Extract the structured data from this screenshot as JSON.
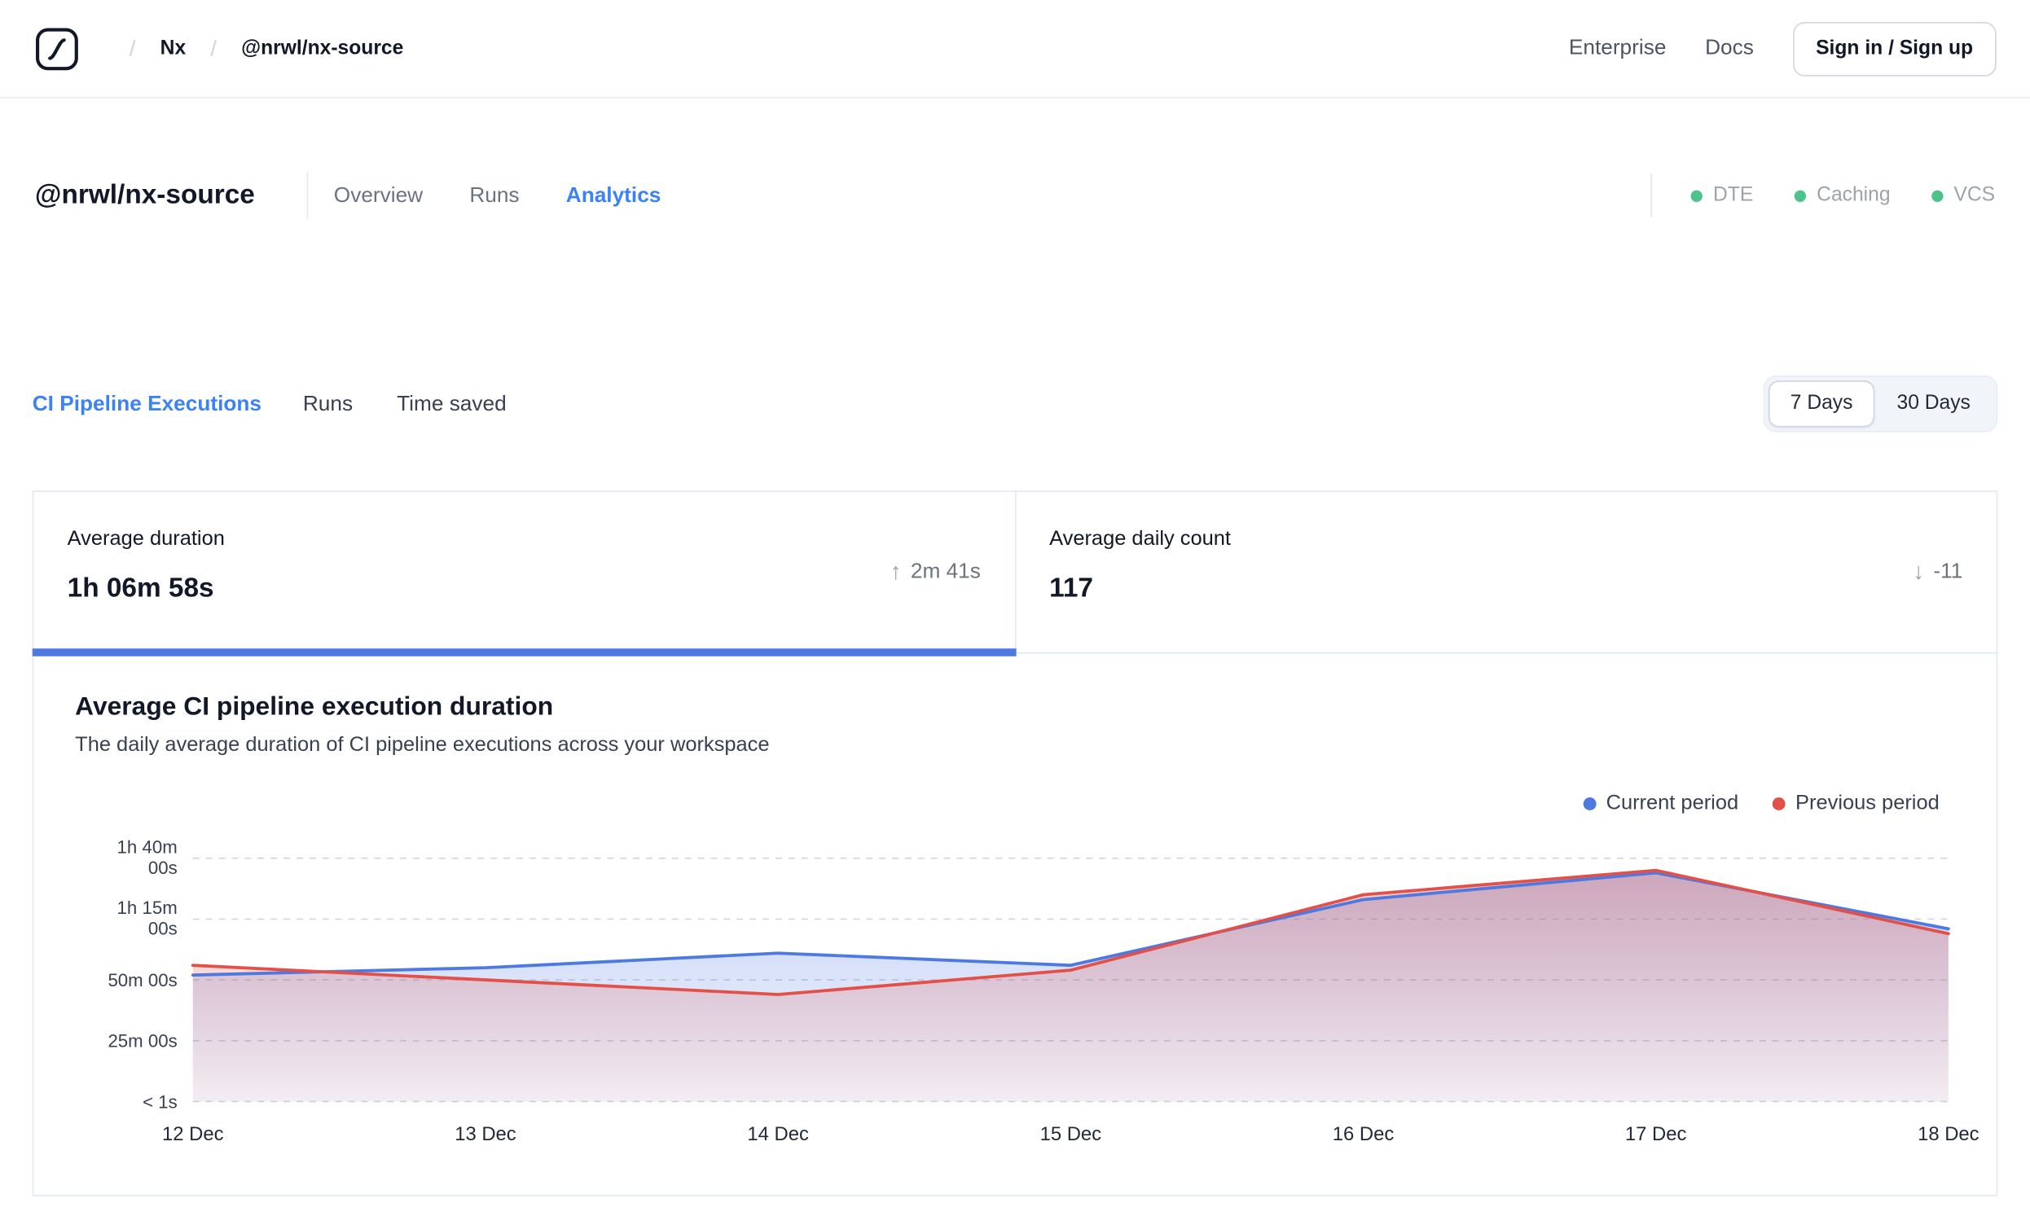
{
  "header": {
    "separator": "/",
    "breadcrumb_org": "Nx",
    "breadcrumb_repo": "@nrwl/nx-source",
    "links": {
      "enterprise": "Enterprise",
      "docs": "Docs"
    },
    "signin_label": "Sign in / Sign up"
  },
  "workspace": {
    "title": "@nrwl/nx-source",
    "tabs": [
      {
        "label": "Overview",
        "active": false
      },
      {
        "label": "Runs",
        "active": false
      },
      {
        "label": "Analytics",
        "active": true
      }
    ],
    "status": [
      {
        "label": "DTE"
      },
      {
        "label": "Caching"
      },
      {
        "label": "VCS"
      }
    ]
  },
  "analytics": {
    "tabs": [
      {
        "label": "CI Pipeline Executions",
        "active": true
      },
      {
        "label": "Runs",
        "active": false
      },
      {
        "label": "Time saved",
        "active": false
      }
    ],
    "range_toggle": {
      "options": [
        "7 Days",
        "30 Days"
      ],
      "selected": "7 Days"
    }
  },
  "stats": [
    {
      "label": "Average duration",
      "value": "1h 06m 58s",
      "delta": "2m 41s",
      "trend": "up",
      "selected": true
    },
    {
      "label": "Average daily count",
      "value": "117",
      "delta": "-11",
      "trend": "down",
      "selected": false
    }
  ],
  "icons": {
    "up_arrow": "↑",
    "down_arrow": "↓"
  },
  "colors": {
    "accent": "#3b82f6",
    "current_period": "#4e79e0",
    "previous_period": "#e2504a",
    "status_dot": "#4dc38b",
    "grid": "#cbd5e1",
    "selected_bar": "#4e79e0"
  },
  "chart_data": {
    "type": "line",
    "title": "Average CI pipeline execution duration",
    "subtitle": "The daily average duration of CI pipeline executions across your workspace",
    "categories": [
      "12 Dec",
      "13 Dec",
      "14 Dec",
      "15 Dec",
      "16 Dec",
      "17 Dec",
      "18 Dec"
    ],
    "unit": "minutes",
    "ylim": [
      0,
      100
    ],
    "y_ticks": [
      {
        "value": 0,
        "lines": [
          "< 1s"
        ]
      },
      {
        "value": 25,
        "lines": [
          "25m 00s"
        ]
      },
      {
        "value": 50,
        "lines": [
          "50m 00s"
        ]
      },
      {
        "value": 75,
        "lines": [
          "1h 15m",
          "00s"
        ]
      },
      {
        "value": 100,
        "lines": [
          "1h 40m",
          "00s"
        ]
      }
    ],
    "grid": "horizontal-dashed",
    "legend_position": "top-right",
    "series": [
      {
        "name": "Current period",
        "color": "#4e79e0",
        "values": [
          52,
          55,
          61,
          56,
          83,
          94,
          71
        ]
      },
      {
        "name": "Previous period",
        "color": "#e2504a",
        "values": [
          56,
          50,
          44,
          54,
          85,
          95,
          69
        ]
      }
    ]
  }
}
